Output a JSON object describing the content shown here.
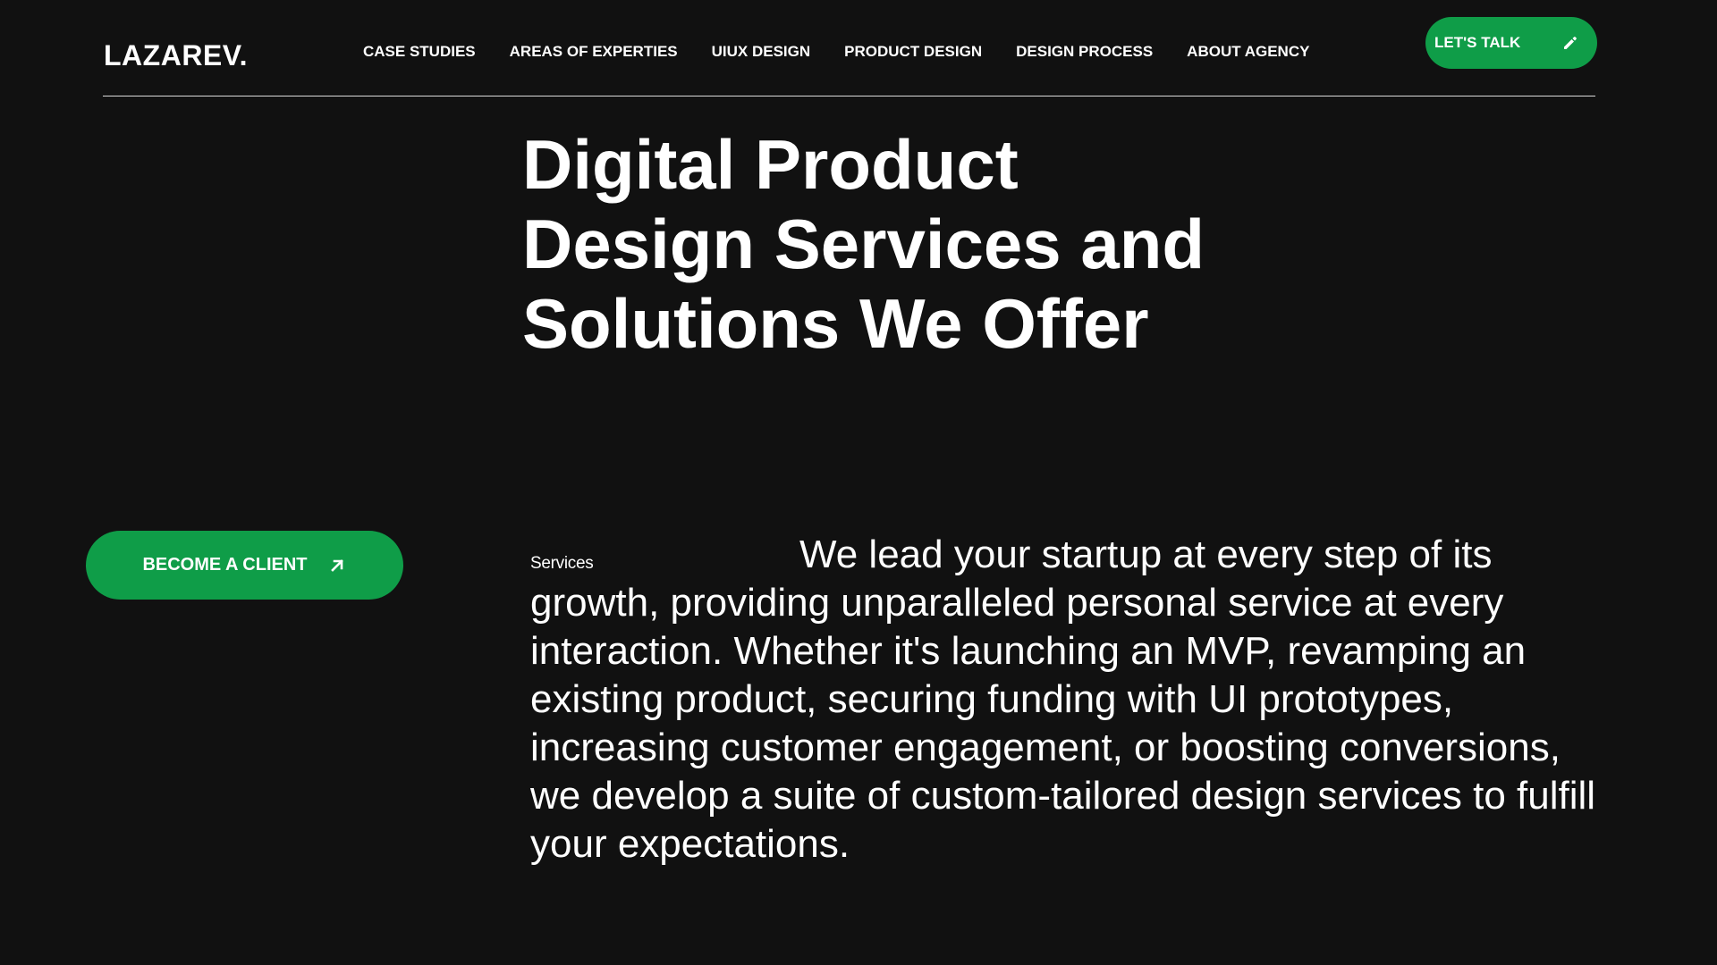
{
  "header": {
    "logo": "LAZAREV.",
    "nav": [
      {
        "label": "CASE STUDIES"
      },
      {
        "label": "AREAS OF EXPERTIES"
      },
      {
        "label": "UIUX DESIGN"
      },
      {
        "label": "PRODUCT DESIGN"
      },
      {
        "label": "DESIGN PROCESS"
      },
      {
        "label": "ABOUT AGENCY"
      }
    ],
    "cta": {
      "label": "LET'S TALK",
      "icon": "pencil-icon"
    }
  },
  "hero": {
    "title": "Digital Product Design Services and Solutions We Offer"
  },
  "sidebar": {
    "cta": {
      "label": "BECOME A CLIENT",
      "icon": "arrow-up-right-icon"
    }
  },
  "services": {
    "label": "Services",
    "text": "We lead your startup at every step of its growth, providing unparalleled personal service at every interaction. Whether it's launching an MVP, revamping an existing product, securing funding with UI prototypes, increasing customer engagement, or boosting conversions, we develop a suite of custom-tailored design services to fulfill your expectations."
  },
  "colors": {
    "background": "#111111",
    "accent": "#0f9d48",
    "text": "#ffffff"
  }
}
